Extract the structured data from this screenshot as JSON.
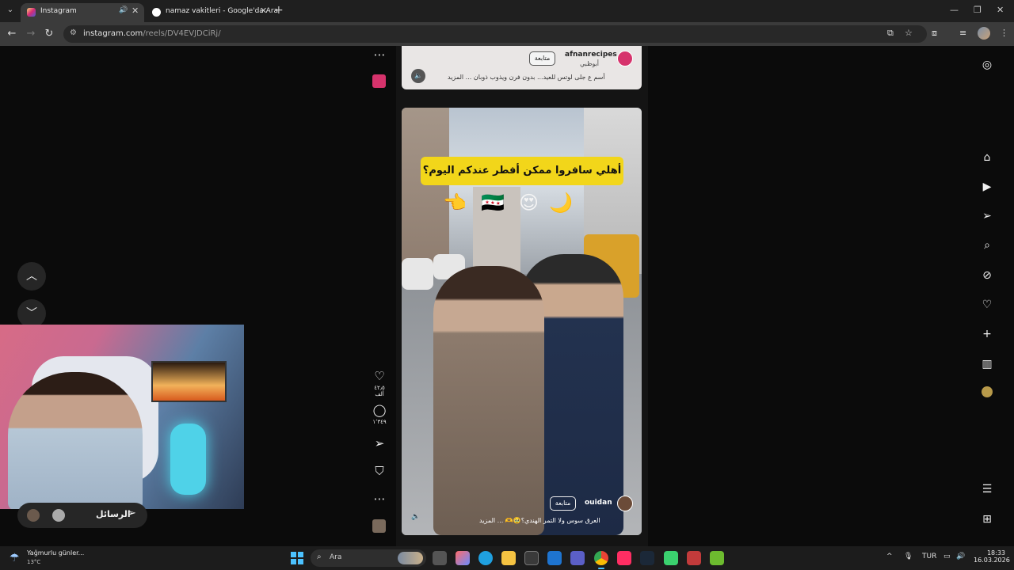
{
  "browser": {
    "tabs": [
      {
        "title": "Instagram",
        "favicon": "instagram-favicon",
        "active": true
      },
      {
        "title": "namaz vakitleri - Google'da Ara",
        "favicon": "google-favicon",
        "active": false
      }
    ],
    "url_domain": "instagram.com",
    "url_path": "/reels/DV4EVJDCiRj/"
  },
  "reel_top": {
    "username": "afnanrecipes",
    "location": "أبوظبي",
    "follow_label": "متابعة",
    "caption": "أسم ع جلى لوتس للعيد... بدون فرن ويذوب ذوبان ... المزيد"
  },
  "reel_main": {
    "banner_text": "أهلي سافروا ممكن أفطر عندكم اليوم؟",
    "emojis": [
      "👈",
      "🇸🇾",
      "😍",
      "🌙"
    ],
    "username": "ouidan",
    "follow_label": "متابعة",
    "caption": "العرق سوس ولا التمر الهندي؟🥹🫶 ... المزيد"
  },
  "actions": {
    "likes": "٤٢٫٥ ألف",
    "comments": "١٬٣٤٩"
  },
  "messages": {
    "label": "الرسائل"
  },
  "taskbar": {
    "weather_text": "Yağmurlu günler...",
    "temperature": "13°C",
    "search_placeholder": "Ara",
    "language": "TUR",
    "time": "18:33",
    "date": "16.03.2026"
  },
  "colors": {
    "accent": "#4cc2ff",
    "banner": "#f2d61a",
    "instagram_pink": "#d6336c"
  }
}
